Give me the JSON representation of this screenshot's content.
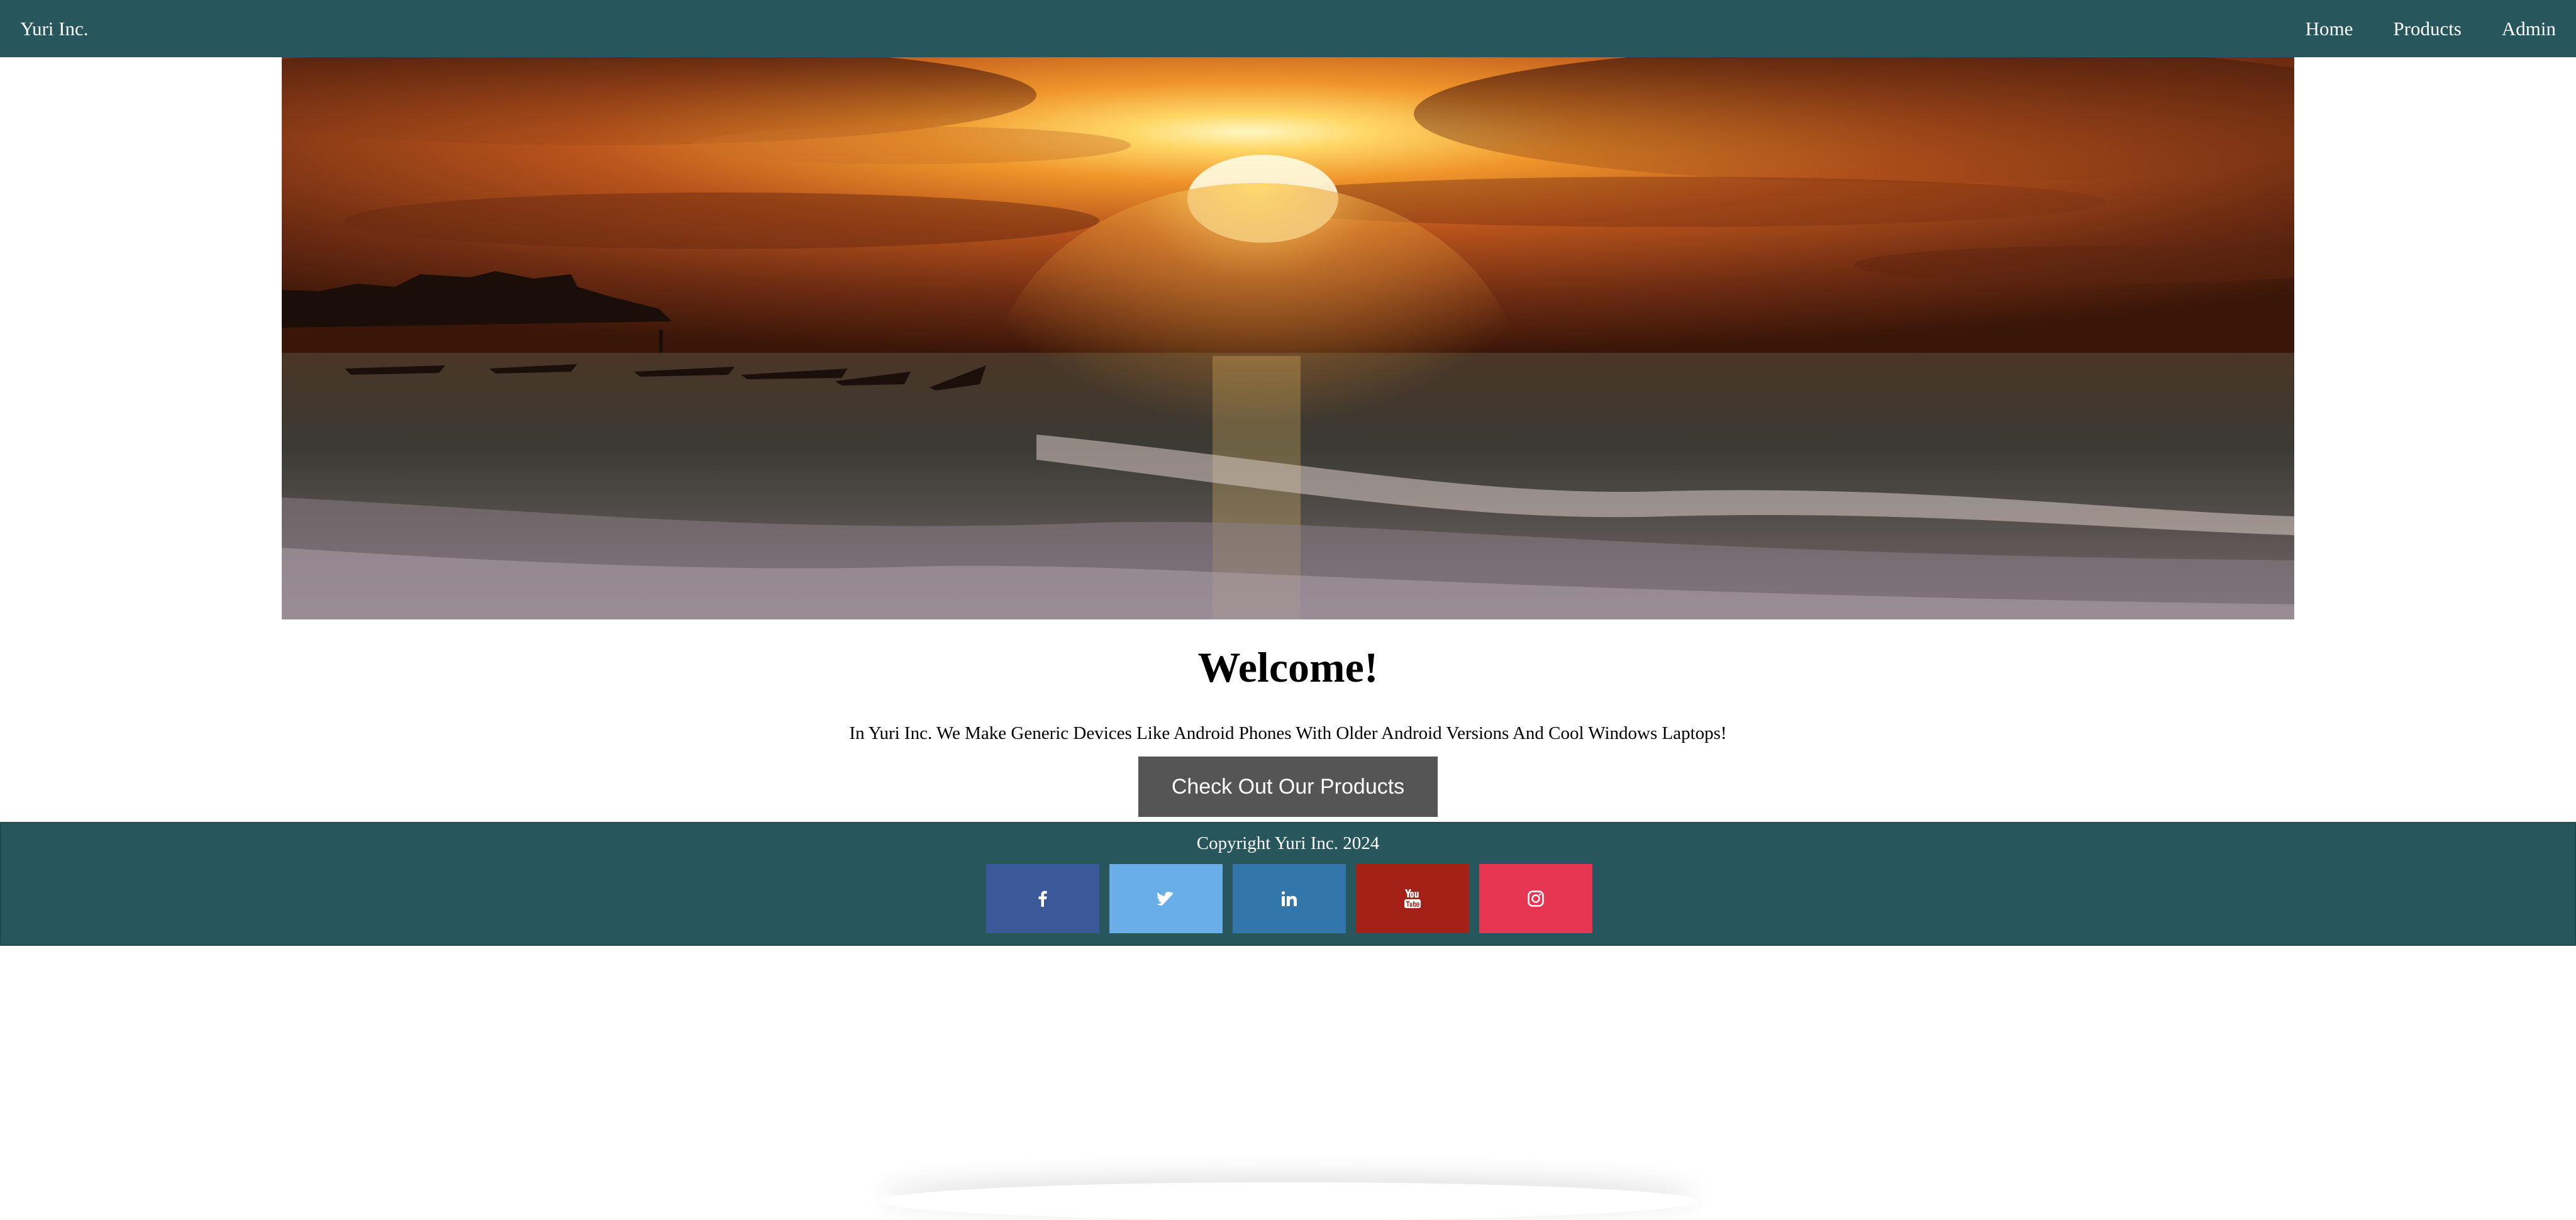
{
  "navbar": {
    "brand": "Yuri Inc.",
    "links": [
      {
        "label": "Home"
      },
      {
        "label": "Products"
      },
      {
        "label": "Admin"
      }
    ],
    "background": "#27565d"
  },
  "hero": {
    "icon": "sunset-beach-image"
  },
  "main": {
    "heading": "Welcome!",
    "tagline": "In Yuri Inc. We Make Generic Devices Like Android Phones With Older Android Versions And Cool Windows Laptops!",
    "cta_label": "Check Out Our Products",
    "cta_color": "#555555"
  },
  "footer": {
    "copyright": "Copyright Yuri Inc. 2024",
    "socials": [
      {
        "icon": "facebook-icon",
        "color": "#3b5998"
      },
      {
        "icon": "twitter-icon",
        "color": "#55acee"
      },
      {
        "icon": "linkedin-icon",
        "color": "#007bb5"
      },
      {
        "icon": "youtube-icon",
        "color": "#bb0000"
      },
      {
        "icon": "instagram-icon",
        "color": "#e91e3c"
      }
    ]
  }
}
